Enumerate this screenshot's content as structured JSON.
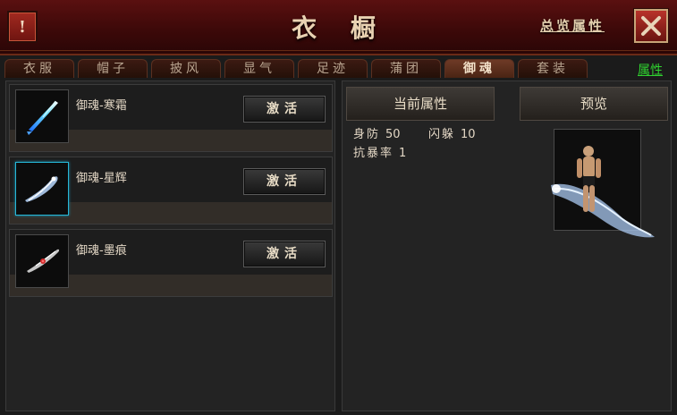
{
  "header": {
    "alert_glyph": "!",
    "title": "衣 橱",
    "overview_link": "总览属性"
  },
  "tabs": [
    {
      "label": "衣服",
      "active": false
    },
    {
      "label": "帽子",
      "active": false
    },
    {
      "label": "披风",
      "active": false
    },
    {
      "label": "显气",
      "active": false
    },
    {
      "label": "足迹",
      "active": false
    },
    {
      "label": "蒲团",
      "active": false
    },
    {
      "label": "御魂",
      "active": true
    },
    {
      "label": "套装",
      "active": false
    }
  ],
  "attr_tab": "属性",
  "items": [
    {
      "name": "御魂-寒霜",
      "button": "激活",
      "icon": "ice-blade-icon",
      "selected": false
    },
    {
      "name": "御魂-星辉",
      "button": "激活",
      "icon": "star-wisp-icon",
      "selected": true
    },
    {
      "name": "御魂-墨痕",
      "button": "激活",
      "icon": "ink-wisp-icon",
      "selected": false
    }
  ],
  "right": {
    "current_attr_button": "当前属性",
    "preview_button": "预览",
    "stats": [
      {
        "label": "身防",
        "value": "50"
      },
      {
        "label": "闪躲",
        "value": "10"
      },
      {
        "label": "抗暴率",
        "value": "1"
      }
    ]
  },
  "colors": {
    "header_red": "#5a1010",
    "attr_tab_green": "#2fd22f",
    "selected_border": "#26b8d8"
  }
}
